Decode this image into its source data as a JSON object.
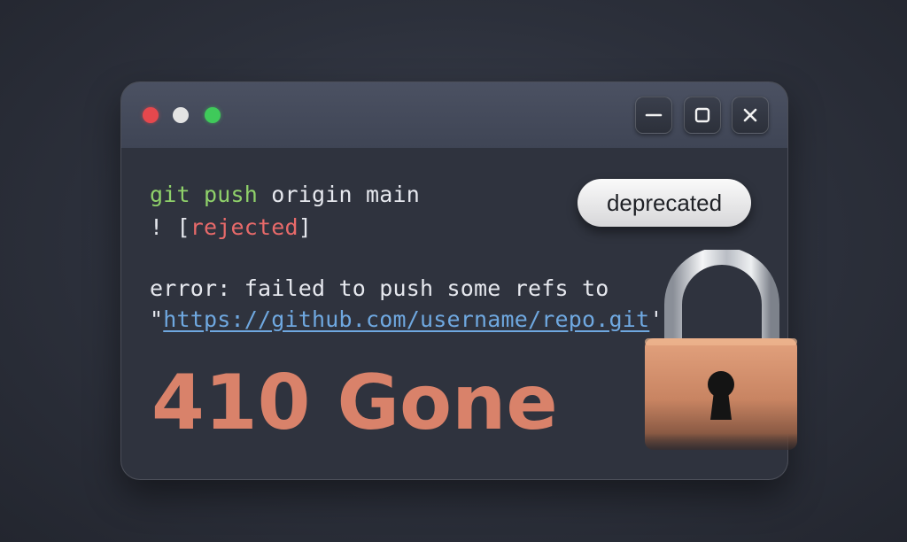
{
  "window": {
    "controls": {
      "minimize_icon": "minimize-icon",
      "maximize_icon": "maximize-icon",
      "close_icon": "close-icon"
    },
    "traffic_lights": [
      "#e5484d",
      "#e3e3e3",
      "#3fca5a"
    ]
  },
  "terminal": {
    "line1_command": "git push",
    "line1_rest": " origin main",
    "line2_prefix": "! [",
    "line2_status": "rejected",
    "line2_suffix": "]",
    "line3": "error: failed to push some refs to",
    "line4_quote_open": "\"",
    "line4_url": "https://github.com/username/repo.git",
    "line4_quote_close": "'"
  },
  "status": {
    "code_text": "410 Gone",
    "badge": "deprecated"
  },
  "colors": {
    "accent_orange": "#d9826a",
    "command_green": "#8fd16a",
    "error_red": "#e86a6a",
    "link_blue": "#6fa8e0"
  },
  "icons": {
    "lock": "padlock-icon"
  }
}
